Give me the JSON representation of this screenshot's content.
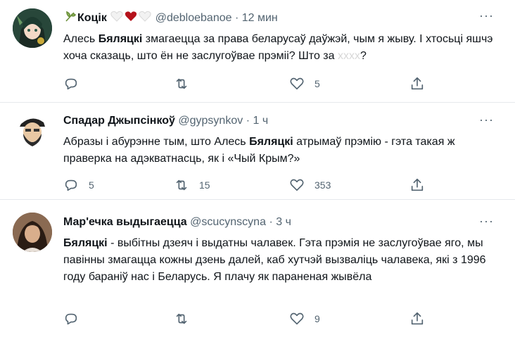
{
  "colors": {
    "text": "#0f1419",
    "muted": "#536471",
    "divider": "#e6e9ec",
    "heart": "#b5121b"
  },
  "tweets": [
    {
      "name": "Коцік",
      "handle": "@debloebanoe",
      "dot": "·",
      "time": "12 мин",
      "text_before": "Алесь ",
      "text_bold": "Бяляцкі",
      "text_after": " змагаецца за права беларусаў даўжэй, чым я жыву. І хтосьці яшчэ хоча сказаць, што ён не заслугоўвае прэміі? Што за ",
      "text_hidden": "xxxx",
      "text_end": "?",
      "reply_count": "",
      "retweet_count": "",
      "like_count": "5",
      "more": "···",
      "avatar_icon": "anime-avatar",
      "name_icons": [
        "plant-emoji-icon",
        "white-heart-icon",
        "red-heart-icon",
        "white-heart-icon"
      ]
    },
    {
      "name": "Спадар Джыпсінкоў",
      "handle": "@gypsynkov",
      "dot": "·",
      "time": "1 ч",
      "text_before": "Абразы і абурэнне тым, што Алесь  ",
      "text_bold": "Бяляцкі",
      "text_after": " атрымаў прэмію - гэта такая ж праверка на адэкватнасць, як і «Чый Крым?»",
      "reply_count": "5",
      "retweet_count": "15",
      "like_count": "353",
      "more": "···",
      "avatar_icon": "bearded-man-avatar"
    },
    {
      "name": "Мар'ечка выдыгаецца",
      "handle": "@scucynscyna",
      "dot": "·",
      "time": "3 ч",
      "text_before": "",
      "text_bold": "Бяляцкі",
      "text_after": " - выбітны дзеяч і выдатны чалавек. Гэта прэмія не заслугоўвае яго, мы павінны змагацца кожны дзень далей, каб хутчэй вызваліць чалавека, які з 1996 году бараніў нас і Беларусь. Я плачу як параненая жывёла",
      "reply_count": "",
      "retweet_count": "",
      "like_count": "9",
      "more": "···",
      "avatar_icon": "woman-avatar"
    }
  ]
}
